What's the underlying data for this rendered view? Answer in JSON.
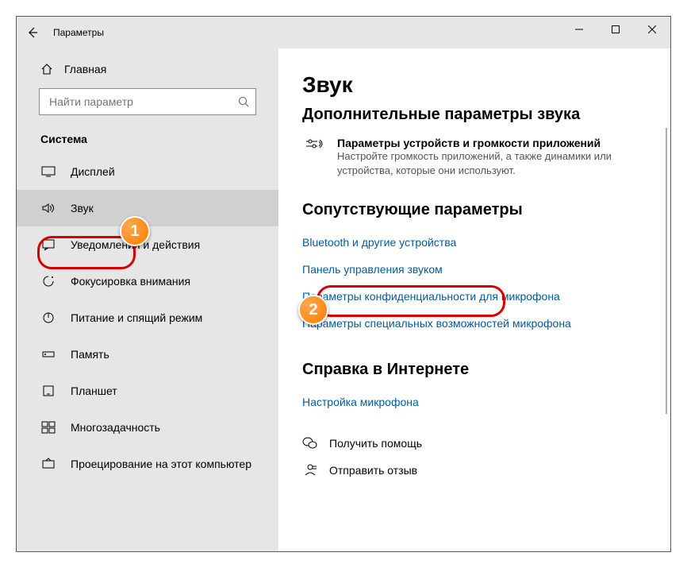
{
  "titlebar": {
    "title": "Параметры"
  },
  "sidebar": {
    "home_label": "Главная",
    "search_placeholder": "Найти параметр",
    "section_label": "Система",
    "items": [
      {
        "label": "Дисплей"
      },
      {
        "label": "Звук"
      },
      {
        "label": "Уведомления и действия"
      },
      {
        "label": "Фокусировка внимания"
      },
      {
        "label": "Питание и спящий режим"
      },
      {
        "label": "Память"
      },
      {
        "label": "Планшет"
      },
      {
        "label": "Многозадачность"
      },
      {
        "label": "Проецирование на этот компьютер"
      }
    ]
  },
  "main": {
    "page_title": "Звук",
    "advanced_heading": "Дополнительные параметры звука",
    "adv_item": {
      "title": "Параметры устройств и громкости приложений",
      "desc": "Настройте громкость приложений, а также динамики или устройства, которые они используют."
    },
    "related_heading": "Сопутствующие параметры",
    "related_links": [
      "Bluetooth и другие устройства",
      "Панель управления звуком",
      "Параметры конфиденциальности для микрофона",
      "Параметры специальных возможностей микрофона"
    ],
    "help_heading": "Справка в Интернете",
    "help_link": "Настройка микрофона",
    "get_help": "Получить помощь",
    "feedback": "Отправить отзыв"
  },
  "annotations": {
    "bubble1": "1",
    "bubble2": "2"
  }
}
